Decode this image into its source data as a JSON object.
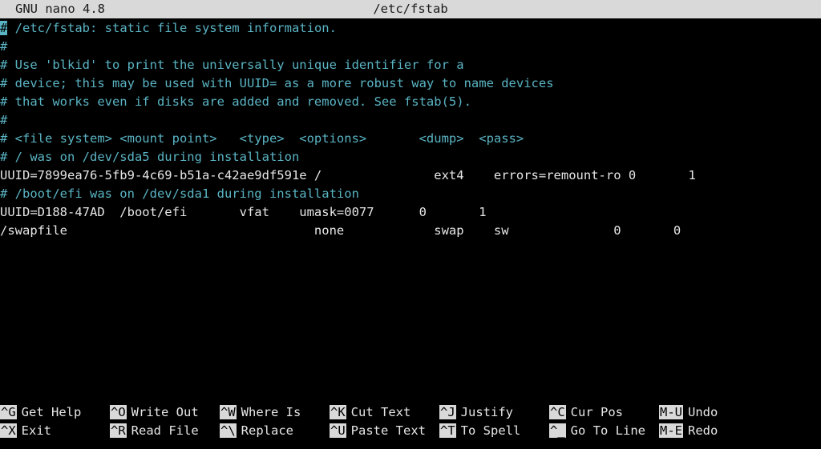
{
  "titlebar": {
    "app": "GNU nano 4.8",
    "filename": "/etc/fstab"
  },
  "editor": {
    "lines": [
      {
        "type": "comment",
        "cursor_char": "#",
        "text": " /etc/fstab: static file system information."
      },
      {
        "type": "comment",
        "text": "#"
      },
      {
        "type": "comment",
        "text": "# Use 'blkid' to print the universally unique identifier for a"
      },
      {
        "type": "comment",
        "text": "# device; this may be used with UUID= as a more robust way to name devices"
      },
      {
        "type": "comment",
        "text": "# that works even if disks are added and removed. See fstab(5)."
      },
      {
        "type": "comment",
        "text": "#"
      },
      {
        "type": "comment",
        "text": "# <file system> <mount point>   <type>  <options>       <dump>  <pass>"
      },
      {
        "type": "comment",
        "text": "# / was on /dev/sda5 during installation"
      },
      {
        "type": "plain",
        "text": "UUID=7899ea76-5fb9-4c69-b51a-c42ae9df591e /               ext4    errors=remount-ro 0       1"
      },
      {
        "type": "comment",
        "text": "# /boot/efi was on /dev/sda1 during installation"
      },
      {
        "type": "plain",
        "text": "UUID=D188-47AD  /boot/efi       vfat    umask=0077      0       1"
      },
      {
        "type": "plain",
        "text": "/swapfile                                 none            swap    sw              0       0"
      }
    ]
  },
  "shortcuts": {
    "row1": [
      {
        "key": "^G",
        "label": "Get Help"
      },
      {
        "key": "^O",
        "label": "Write Out"
      },
      {
        "key": "^W",
        "label": "Where Is"
      },
      {
        "key": "^K",
        "label": "Cut Text"
      },
      {
        "key": "^J",
        "label": "Justify"
      },
      {
        "key": "^C",
        "label": "Cur Pos"
      },
      {
        "key": "M-U",
        "label": "Undo"
      }
    ],
    "row2": [
      {
        "key": "^X",
        "label": "Exit"
      },
      {
        "key": "^R",
        "label": "Read File"
      },
      {
        "key": "^\\",
        "label": "Replace"
      },
      {
        "key": "^U",
        "label": "Paste Text"
      },
      {
        "key": "^T",
        "label": "To Spell"
      },
      {
        "key": "^_",
        "label": "Go To Line"
      },
      {
        "key": "M-E",
        "label": "Redo"
      }
    ]
  },
  "colors": {
    "comment": "#5ab4c4",
    "background": "#000000",
    "titlebar": "#d9d9d9"
  }
}
